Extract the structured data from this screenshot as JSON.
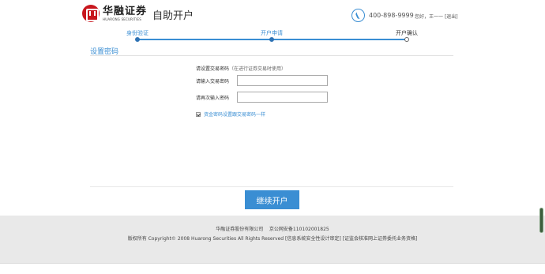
{
  "header": {
    "logo_cn": "华融证券",
    "logo_en": "HUARONG SECURITIES",
    "title": "自助开户",
    "hotline": "400-898-9999",
    "greeting": "您好，王一一",
    "logout": "[退出]"
  },
  "steps": [
    {
      "label": "身份验证",
      "state": "done"
    },
    {
      "label": "开户申请",
      "state": "current"
    },
    {
      "label": "开户确认",
      "state": "pending"
    }
  ],
  "section": {
    "title": "设置密码"
  },
  "form": {
    "heading": "请设置交易密码",
    "heading_note": "（在进行证券交易时使用）",
    "password_label": "请输入交易密码",
    "password_value": "",
    "confirm_label": "请再次输入密码",
    "confirm_value": "",
    "agree_text": "资金密码设置跟交易密码一样",
    "agree_checked": true
  },
  "buttons": {
    "continue": "继续开户"
  },
  "footer": {
    "company": "华融证券股份有限公司",
    "icp": "京公网安备110102001825",
    "copyright": "版权所有 Copyright© 2008 Huarong Securities All Rights Reserved [信息系统安全性设计审定] [证监会核准网上证券委托业务资格]"
  },
  "colors": {
    "accent": "#3a8ed3",
    "brand": "#c8161d",
    "footer_bg": "#e9e9e9"
  }
}
